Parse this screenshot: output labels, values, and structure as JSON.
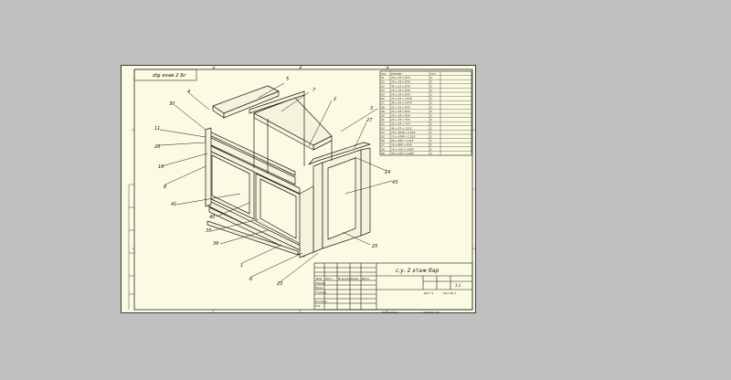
{
  "sheet": {
    "corner_stamp": "dig изав 2 Бг",
    "balloons": [
      "5",
      "7",
      "4",
      "30",
      "2",
      "3",
      "27",
      "11",
      "28",
      "10",
      "8",
      "41",
      "40",
      "35",
      "39",
      "1",
      "6",
      "23",
      "25",
      "24",
      "43"
    ],
    "zones_top": [
      "1",
      "2",
      "3",
      "4"
    ],
    "spec_table": {
      "headers": [
        "поз",
        "размер",
        "кол"
      ],
      "rows": [
        [
          "21",
          "16 x 25 x 870",
          "2"
        ],
        [
          "22",
          "16 x 25 x 870",
          "2"
        ],
        [
          "23",
          "40 x 25 x 870",
          "2"
        ],
        [
          "24",
          "16 x 25 x 870",
          "2"
        ],
        [
          "25",
          "16 x 25 x 870",
          "2"
        ],
        [
          "26",
          "16 x 25 x 1070",
          "2"
        ],
        [
          "27",
          "30 x 25 x 1070",
          "2"
        ],
        [
          "28",
          "22 x 18 x 870",
          "2"
        ],
        [
          "29",
          "22 x 18 x 870",
          "2"
        ],
        [
          "30",
          "18 x 18 x 930",
          "2"
        ],
        [
          "31",
          "22 x 25 x 715",
          "2"
        ],
        [
          "32",
          "22 x 25 x 715",
          "2"
        ],
        [
          "33",
          "40 x 25 x 1215",
          "1"
        ],
        [
          "34",
          "16 x 1000 x 1215",
          "1"
        ],
        [
          "35",
          "10 x 1000 x 1215",
          "1"
        ],
        [
          "36",
          "90 x 360 x 1215",
          "1"
        ],
        [
          "37",
          "16 x 890 x 930",
          "1"
        ],
        [
          "38",
          "16 x 120 x 1050",
          "1"
        ],
        [
          "39",
          "16 x 120 x 1200",
          "1"
        ]
      ]
    },
    "title_block": {
      "title": "с.у. 2 этаж бар",
      "scale": "1:1",
      "sheet": "Лист 1",
      "sheets": "Листов 1",
      "format": "Формат А3",
      "copied": "Копировал",
      "col_headers": [
        "Изм",
        "Лист",
        "№ докум.",
        "Подп.",
        "Дата"
      ],
      "row_labels": [
        "Разраб.",
        "Пров.",
        "Т.контр.",
        "Н.контр.",
        "Утв."
      ]
    }
  }
}
